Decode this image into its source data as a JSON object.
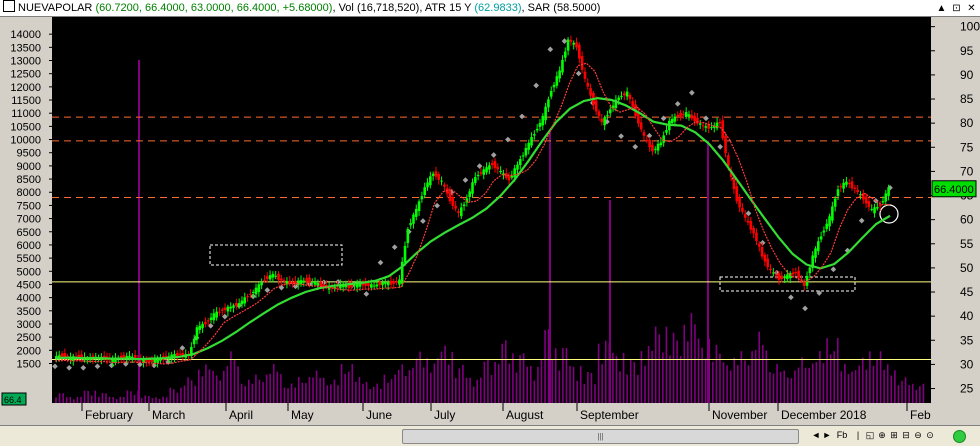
{
  "window": {
    "symbol": "NUEVAPOLAR",
    "ohlc_text": "(60.7200, 66.4000, 63.0000, 66.4000, +5.68000)",
    "vol_label": "Vol",
    "vol_text": "(16,718,520)",
    "atr_label": "ATR 15 Y",
    "atr_text": "(62.9833)",
    "sar_label": "SAR",
    "sar_text": "(58.5000)",
    "controls": [
      "▲",
      "⊡",
      "✕"
    ]
  },
  "colors": {
    "background": "#000000",
    "up_candle": "#00ff00",
    "down_candle": "#ff0000",
    "ma_slow": "#33dd33",
    "ma_fast": "#ff3b3b",
    "sar_dots": "#a0a0a0",
    "volume": "#800080",
    "resistance": "#ff6a33",
    "support": "#ffff80"
  },
  "chart_data": {
    "type": "candlestick",
    "left_axis": {
      "ticks": [
        "1500",
        "2000",
        "2500",
        "3000",
        "3500",
        "4000",
        "4500",
        "5000",
        "5500",
        "6000",
        "6500",
        "7000",
        "7500",
        "8000",
        "8500",
        "9000",
        "9500",
        "10000",
        "10500",
        "11000",
        "11500",
        "12000",
        "12500",
        "13000",
        "13500",
        "14000"
      ],
      "range": [
        0,
        14500
      ]
    },
    "right_axis": {
      "ticks": [
        "25",
        "30",
        "35",
        "40",
        "45",
        "50",
        "55",
        "60",
        "65",
        "70",
        "75",
        "80",
        "85",
        "90",
        "95",
        "100"
      ],
      "range": [
        22,
        102
      ]
    },
    "x_labels": [
      "February",
      "March",
      "April",
      "May",
      "June",
      "July",
      "August",
      "September",
      "November",
      "December 2018",
      "Feb"
    ],
    "last_price_label": "66.4000",
    "left_corner_label": "66.4",
    "price_series_right_units": [
      31.5,
      31.8,
      31.3,
      31.6,
      31.1,
      31.5,
      31.2,
      30.9,
      31.4,
      31.6,
      31.0,
      30.6,
      30.8,
      31.2,
      31.8,
      32.1,
      31.7,
      37.5,
      38.6,
      40.3,
      41.3,
      41.9,
      42.6,
      44.2,
      45.6,
      47.7,
      48.6,
      47.4,
      46.8,
      47.1,
      47.4,
      46.8,
      46.2,
      45.9,
      46.4,
      46.1,
      46.7,
      46.5,
      46.3,
      46.9,
      46.8,
      47.3,
      58.3,
      62.1,
      66.7,
      69.7,
      67.8,
      64.1,
      61.2,
      64.5,
      68.9,
      70.2,
      71.6,
      69.8,
      68.3,
      71.4,
      74.7,
      78.0,
      81.2,
      86.9,
      90.8,
      97.3,
      95.9,
      88.9,
      84.1,
      80.0,
      82.9,
      85.4,
      86.3,
      81.8,
      77.1,
      74.3,
      76.0,
      80.3,
      81.6,
      82.0,
      80.6,
      79.3,
      79.1,
      80.2,
      70.8,
      64.1,
      60.2,
      57.2,
      52.5,
      49.3,
      47.8,
      48.4,
      49.1,
      46.3,
      52.4,
      56.8,
      60.4,
      66.5,
      67.8,
      66.3,
      64.4,
      61.9,
      63.0,
      66.4
    ],
    "ma_slow": [
      31.3,
      31.4,
      31.3,
      31.3,
      31.2,
      31.2,
      31.1,
      31.2,
      31.3,
      31.6,
      32.2,
      33.4,
      34.9,
      36.7,
      38.7,
      40.6,
      42.4,
      43.8,
      45.0,
      45.8,
      46.3,
      46.6,
      46.9,
      47.3,
      48.3,
      50.4,
      53.1,
      55.5,
      57.3,
      58.9,
      60.4,
      62.3,
      64.9,
      68.2,
      72.1,
      76.3,
      80.2,
      83.0,
      84.6,
      85.2,
      84.8,
      83.7,
      82.1,
      80.3,
      79.7,
      79.5,
      78.1,
      75.7,
      72.3,
      68.3,
      64.2,
      60.2,
      56.3,
      52.9,
      50.7,
      49.9,
      50.8,
      53.2,
      56.2,
      59.1,
      60.8
    ],
    "sar_levels": [
      29.6,
      29.3,
      29.3,
      29.6,
      29.8,
      30.1,
      30.0,
      29.8,
      30.5,
      33.4,
      35.5,
      38.0,
      39.9,
      42.2,
      44.1,
      45.4,
      45.9,
      46.2,
      46.7,
      47.0,
      47.1,
      46.4,
      44.6,
      51.1,
      54.3,
      57.5,
      59.7,
      62.9,
      65.6,
      68.2,
      71.1,
      73.4,
      76.6,
      81.4,
      87.8,
      95.3,
      97.0,
      90.3,
      84.2,
      80.3,
      77.3,
      75.1,
      77.4,
      81.0,
      84.0,
      86.3,
      81.0,
      75.1,
      68.5,
      61.3,
      55.2,
      49.0,
      43.9,
      41.6,
      44.8,
      49.7,
      53.6,
      59.8,
      63.9,
      66.6
    ],
    "volume_relative": [
      0.08,
      0.05,
      0.1,
      0.08,
      0.05,
      0.1,
      0.06,
      0.05,
      0.12,
      0.2,
      0.3,
      0.25,
      0.4,
      0.18,
      0.22,
      0.3,
      0.15,
      0.2,
      0.25,
      0.18,
      0.3,
      0.2,
      0.15,
      0.22,
      0.3,
      0.4,
      0.35,
      0.45,
      0.3,
      0.2,
      0.35,
      0.5,
      0.4,
      0.3,
      0.6,
      0.45,
      0.3,
      0.25,
      0.5,
      0.4,
      0.35,
      0.45,
      0.6,
      0.55,
      0.7,
      0.5,
      0.45,
      0.35,
      0.4,
      0.55,
      0.3,
      0.25,
      0.35,
      0.4,
      0.5,
      0.3,
      0.35,
      0.4,
      0.3,
      0.2,
      0.15
    ],
    "volume_spikes_relative": [
      0.98,
      0.8,
      0.9,
      1.0
    ],
    "resistance_lines_price": [
      10850,
      9950,
      7800
    ],
    "support_lines_price": [
      4600,
      1650
    ],
    "annotations": [
      {
        "type": "box",
        "label": "consolidation-april-may"
      },
      {
        "type": "box",
        "label": "consolidation-november-december"
      },
      {
        "type": "circle",
        "label": "last-bar-highlight"
      }
    ]
  },
  "scrollbar": {
    "thumb_label": "|||",
    "buttons": [
      "◄",
      "►",
      "Fb",
      "|",
      "◱",
      "⊕",
      "⊞",
      "⊟",
      "⊖",
      "⊙"
    ]
  }
}
